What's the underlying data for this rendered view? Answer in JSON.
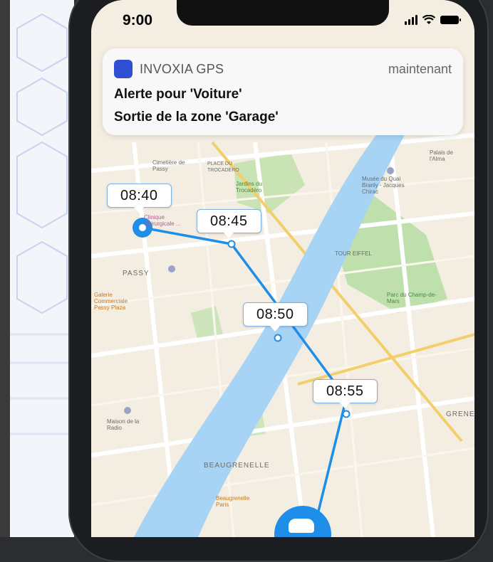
{
  "status_bar": {
    "time": "9:00"
  },
  "notification": {
    "app_name": "INVOXIA GPS",
    "time": "maintenant",
    "title": "Alerte pour 'Voiture'",
    "body": "Sortie de la zone 'Garage'",
    "app_color": "#2f4fd2"
  },
  "route": {
    "color": "#1e8ee8",
    "timestamps": [
      "08:40",
      "08:45",
      "08:50",
      "08:55"
    ]
  },
  "map_labels": {
    "cimetiere": "Cimetière de Passy",
    "trocadero_place": "PLACE DU TROCADÉRO",
    "jardins": "Jardins du Trocadéro",
    "quai_branly_museum": "Musée du Quai Branly - Jacques Chirac",
    "palais_alma": "Palais de l'Alma",
    "clinique": "Clinique Chirurgicale ...",
    "passy": "PASSY",
    "tour_eiffel": "TOUR EIFFEL",
    "galerie": "Galerie Commerciale Passy Plaza",
    "champ_de_mars": "Parc du Champ-de-Mars",
    "maison_radio": "Maison de la Radio",
    "grenelle": "GRENE",
    "beaugrenelle": "BEAUGRENELLE",
    "beaugrenelle_paris": "Beaugrenelle Paris"
  }
}
